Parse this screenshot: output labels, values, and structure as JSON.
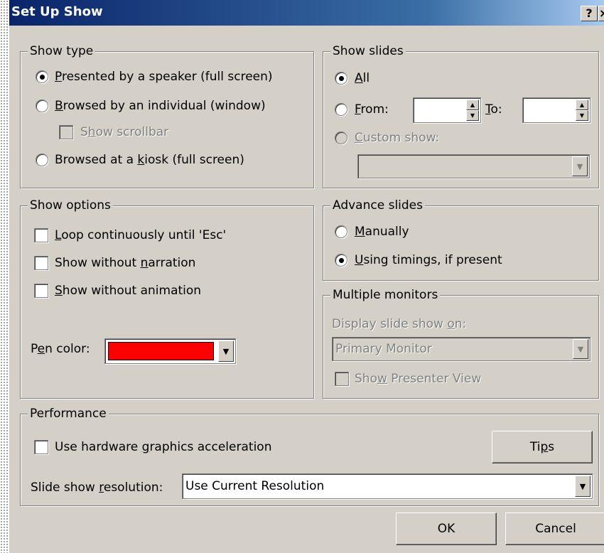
{
  "window": {
    "title": "Set Up Show",
    "help_button": "?",
    "close_button": "×"
  },
  "show_type": {
    "legend": "Show type",
    "options": [
      {
        "label": "Presented by a speaker (full screen)",
        "mnemonic": "P",
        "selected": true
      },
      {
        "label": "Browsed by an individual (window)",
        "mnemonic": "B",
        "selected": false
      },
      {
        "label": "Browsed at a kiosk (full screen)",
        "mnemonic": "k",
        "selected": false
      }
    ],
    "show_scrollbar": {
      "label": "Show scrollbar",
      "checked": false,
      "enabled": false
    }
  },
  "show_slides": {
    "legend": "Show slides",
    "all_label": "All",
    "from_label": "From:",
    "to_label": "To:",
    "from_value": "",
    "to_value": "",
    "custom_show_label": "Custom show:",
    "custom_show_value": "",
    "selected": "All"
  },
  "show_options": {
    "legend": "Show options",
    "loop_label": "Loop continuously until 'Esc'",
    "no_narration_label": "Show without narration",
    "no_animation_label": "Show without animation",
    "pen_color_label": "Pen color:",
    "pen_color": "#ff0000"
  },
  "advance_slides": {
    "legend": "Advance slides",
    "manually_label": "Manually",
    "timings_label": "Using timings, if present",
    "selected": "Using timings, if present"
  },
  "multiple_monitors": {
    "legend": "Multiple monitors",
    "display_on_label": "Display slide show on:",
    "monitor_value": "Primary Monitor",
    "presenter_view_label": "Show Presenter View",
    "presenter_view_checked": false
  },
  "performance": {
    "legend": "Performance",
    "hw_accel_label": "Use hardware graphics acceleration",
    "hw_accel_checked": false,
    "tips_button": "Tips",
    "resolution_label": "Slide show resolution:",
    "resolution_value": "Use Current Resolution"
  },
  "buttons": {
    "ok": "OK",
    "cancel": "Cancel"
  },
  "colors": {
    "dialog_bg": "#d4d0c8",
    "title_bar": "#0a246a",
    "pen_color": "#ff0000"
  }
}
